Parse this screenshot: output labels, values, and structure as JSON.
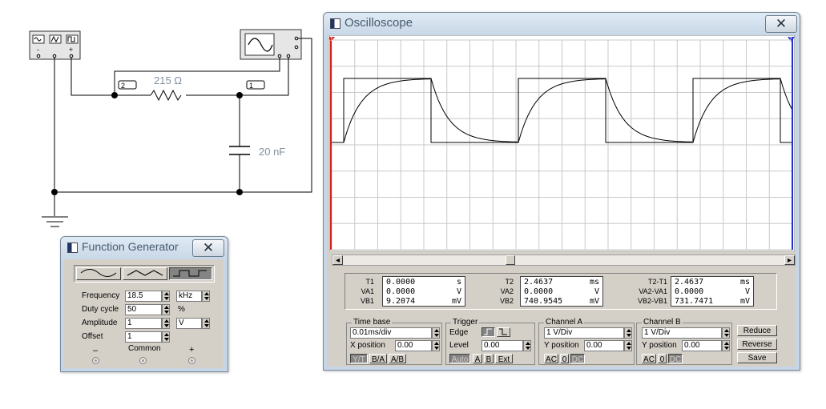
{
  "circuit": {
    "resistor_label": "215 Ω",
    "capacitor_label": "20 nF",
    "node2_label": "2",
    "node1_label": "1",
    "fg_terminals": [
      "-",
      "○",
      "+"
    ]
  },
  "oscilloscope": {
    "title": "Oscilloscope",
    "close_symbol": "✕",
    "cursor1_label": "1",
    "cursor2_label": "2",
    "scroll_left": "◂",
    "scroll_right": "▸",
    "measure": {
      "c1": {
        "labels": [
          "T1",
          "VA1",
          "VB1"
        ],
        "values": [
          "0.0000",
          "0.0000",
          "9.2074"
        ],
        "units": [
          "s",
          "V",
          "mV"
        ]
      },
      "c2": {
        "labels": [
          "T2",
          "VA2",
          "VB2"
        ],
        "values": [
          "2.4637",
          "0.0000",
          "740.9545"
        ],
        "units": [
          "ms",
          "V",
          "mV"
        ]
      },
      "c3": {
        "labels": [
          "T2-T1",
          "VA2-VA1",
          "VB2-VB1"
        ],
        "values": [
          "2.4637",
          "0.0000",
          "731.7471"
        ],
        "units": [
          "ms",
          "V",
          "mV"
        ]
      }
    },
    "timebase": {
      "title": "Time base",
      "value": "0.01ms/div",
      "xpos_label": "X position",
      "xpos_value": "0.00",
      "modes": [
        "Y/T",
        "B/A",
        "A/B"
      ]
    },
    "trigger": {
      "title": "Trigger",
      "edge_label": "Edge",
      "level_label": "Level",
      "level_value": "0.00",
      "modes": [
        "Auto",
        "A",
        "B",
        "Ext"
      ]
    },
    "channel_a": {
      "title": "Channel A",
      "value": "1 V/Div",
      "ypos_label": "Y position",
      "ypos_value": "0.00",
      "coupling": [
        "AC",
        "0",
        "DC"
      ]
    },
    "channel_b": {
      "title": "Channel B",
      "value": "1 V/Div",
      "ypos_label": "Y position",
      "ypos_value": "0.00",
      "coupling": [
        "AC",
        "0",
        "DC"
      ]
    },
    "buttons": [
      "Reduce",
      "Reverse",
      "Save"
    ]
  },
  "function_generator": {
    "title": "Function Generator",
    "close_symbol": "✕",
    "frequency": {
      "label": "Frequency",
      "value": "18.5",
      "unit": "kHz"
    },
    "duty_cycle": {
      "label": "Duty cycle",
      "value": "50",
      "unit": "%"
    },
    "amplitude": {
      "label": "Amplitude",
      "value": "1",
      "unit": "V"
    },
    "offset": {
      "label": "Offset",
      "value": "1"
    },
    "terminals": {
      "minus": "–",
      "common": "Common",
      "plus": "+"
    }
  },
  "colors": {
    "trace": "#000000",
    "grid": "#c8c8c8",
    "cursor_red": "#d42020",
    "cursor_blue": "#2030c8",
    "wire": "#000000",
    "circuit_label": "#8090a0"
  }
}
